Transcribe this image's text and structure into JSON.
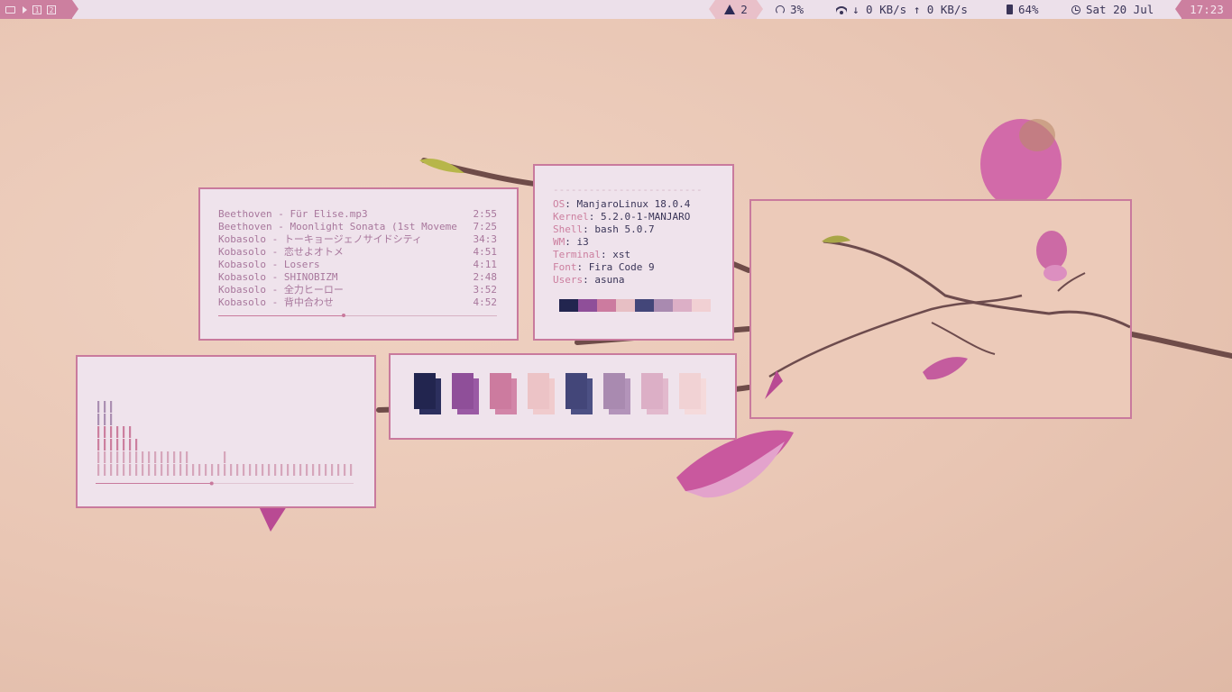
{
  "topbar": {
    "workspaces": [
      "1",
      "2"
    ],
    "updates": "2",
    "cpu": "3%",
    "network": "↓ 0 KB/s ↑ 0 KB/s",
    "battery": "64%",
    "date": "Sat 20 Jul",
    "time": "17:23"
  },
  "playlist": {
    "tracks": [
      {
        "title": "Beethoven - Für Elise.mp3",
        "duration": "2:55"
      },
      {
        "title": "Beethoven - Moonlight Sonata (1st Moveme",
        "duration": "7:25"
      },
      {
        "title": "Kobasolo - トーキョージェノサイドシティ",
        "duration": "34:3"
      },
      {
        "title": "Kobasolo - 恋せよオトメ",
        "duration": "4:51"
      },
      {
        "title": "Kobasolo - Losers",
        "duration": "4:11"
      },
      {
        "title": "Kobasolo - SHINOBIZM",
        "duration": "2:48"
      },
      {
        "title": "Kobasolo - 全力ヒーロー",
        "duration": "3:52"
      },
      {
        "title": "Kobasolo - 背中合わせ",
        "duration": "4:52"
      }
    ],
    "progress": 0.45
  },
  "sysinfo": {
    "separator": "-------------------------",
    "rows": [
      {
        "key": "OS",
        "value": "ManjaroLinux 18.0.4"
      },
      {
        "key": "Kernel",
        "value": "5.2.0-1-MANJARO"
      },
      {
        "key": "Shell",
        "value": "bash 5.0.7"
      },
      {
        "key": "WM",
        "value": "i3"
      },
      {
        "key": "Terminal",
        "value": "xst"
      },
      {
        "key": "Font",
        "value": "Fira Code 9"
      },
      {
        "key": "Users",
        "value": "asuna"
      }
    ],
    "colors": [
      "#22254f",
      "#8f4f99",
      "#cc7b9f",
      "#e7bfc4",
      "#434679",
      "#a98ab0",
      "#dcafc6",
      "#f1d0d3"
    ]
  },
  "visualizer": {
    "levels": [
      0.8,
      0.7,
      0.7,
      0.5,
      0.5,
      0.5,
      0.4,
      0.3,
      0.3,
      0.2,
      0.2,
      0.2,
      0.2,
      0.2,
      0.2,
      0.1,
      0.1,
      0.1,
      0.1,
      0.1,
      0.2,
      0.1,
      0.1,
      0.1,
      0.1,
      0.1,
      0.1,
      0.1,
      0.1,
      0.1,
      0.1,
      0.1,
      0.1,
      0.1,
      0.1,
      0.1,
      0.1,
      0.1,
      0.1,
      0.1,
      0.1
    ],
    "progress": 0.45
  },
  "palette": {
    "swatches": [
      {
        "front": "#22254f",
        "back": "#2c2f5e"
      },
      {
        "front": "#8f4f99",
        "back": "#9a5aa4"
      },
      {
        "front": "#cc7b9f",
        "back": "#d285a8"
      },
      {
        "front": "#ecc3c6",
        "back": "#f0cbcd"
      },
      {
        "front": "#434679",
        "back": "#4c5084"
      },
      {
        "front": "#a98ab0",
        "back": "#b394ba"
      },
      {
        "front": "#dcafc6",
        "back": "#e2b9cd"
      },
      {
        "front": "#f1d2d4",
        "back": "#f5dadb"
      }
    ]
  }
}
